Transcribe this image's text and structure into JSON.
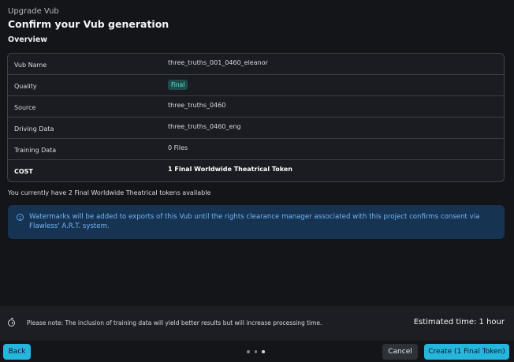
{
  "header": {
    "subtitle": "Upgrade Vub",
    "title": "Confirm your Vub generation"
  },
  "overview_label": "Overview",
  "details": [
    {
      "key": "Vub Name",
      "value": "three_truths_001_0460_eleanor"
    },
    {
      "key": "Quality",
      "value": "Final"
    },
    {
      "key": "Source",
      "value": "three_truths_0460"
    },
    {
      "key": "Driving Data",
      "value": "three_truths_0460_eng"
    },
    {
      "key": "Training Data",
      "value": "0 Files"
    },
    {
      "key": "COST",
      "value": "1 Final Worldwide Theatrical Token"
    }
  ],
  "tokens_available": "You currently have 2 Final Worldwide Theatrical tokens available",
  "info_message": "Watermarks will be added to exports of this Vub until the rights clearance manager associated with this project confirms consent via Flawless' A.R.T. system.",
  "footer": {
    "note": "Please note: The inclusion of training data will yield better results but will increase processing time.",
    "estimated_time": "Estimated time: 1 hour"
  },
  "buttons": {
    "back": "Back",
    "cancel": "Cancel",
    "create": "Create (1 Final Token)"
  },
  "pagination": {
    "total": 3,
    "active": 3
  },
  "colors": {
    "accent": "#25b6de",
    "info_bg": "#173352",
    "info_text": "#73b4f2",
    "badge_bg": "#1d4b4c",
    "badge_text": "#67e0d8"
  },
  "icons": {
    "info": "info-circle-icon",
    "timer": "stopwatch-icon"
  }
}
